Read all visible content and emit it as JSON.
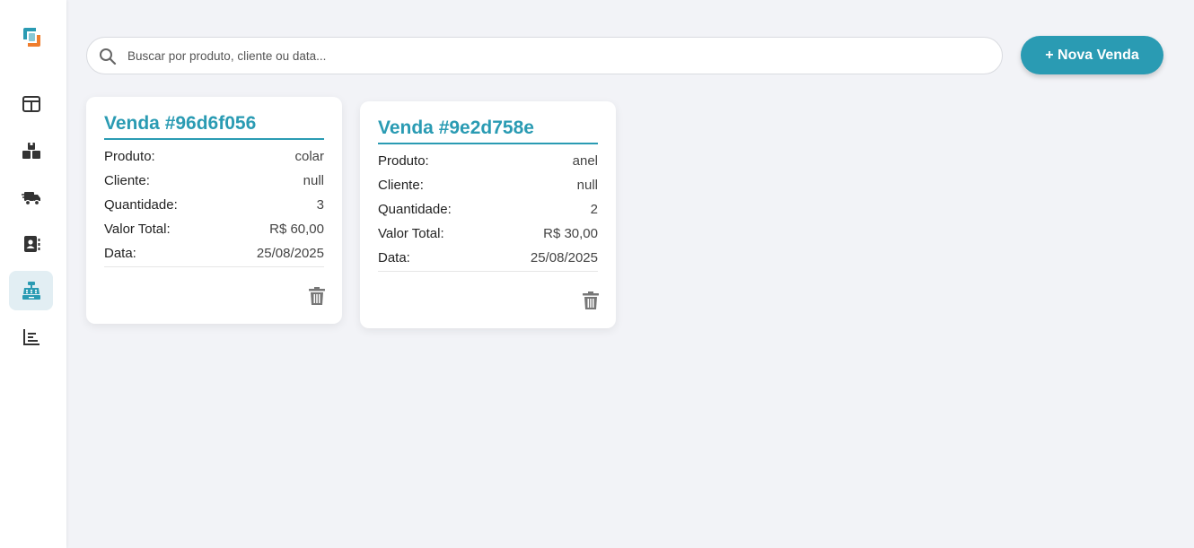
{
  "colors": {
    "accent": "#2a9bb3",
    "background": "#f2f3f7",
    "nav_active_bg": "#e2eef3"
  },
  "sidebar": {
    "items": [
      {
        "icon": "dashboard-icon",
        "active": false
      },
      {
        "icon": "products-boxes-icon",
        "active": false
      },
      {
        "icon": "delivery-truck-icon",
        "active": false
      },
      {
        "icon": "contacts-book-icon",
        "active": false
      },
      {
        "icon": "cash-register-icon",
        "active": true
      },
      {
        "icon": "bar-chart-icon",
        "active": false
      }
    ]
  },
  "search": {
    "placeholder": "Buscar por produto, cliente ou data..."
  },
  "actions": {
    "new_sale_label": "+ Nova Venda"
  },
  "labels": {
    "produto": "Produto:",
    "cliente": "Cliente:",
    "quantidade": "Quantidade:",
    "valor_total": "Valor Total:",
    "data": "Data:"
  },
  "sales": [
    {
      "title": "Venda #96d6f056",
      "produto": "colar",
      "cliente": "null",
      "quantidade": "3",
      "valor_total": "R$ 60,00",
      "data": "25/08/2025"
    },
    {
      "title": "Venda #9e2d758e",
      "produto": "anel",
      "cliente": "null",
      "quantidade": "2",
      "valor_total": "R$ 30,00",
      "data": "25/08/2025"
    }
  ]
}
